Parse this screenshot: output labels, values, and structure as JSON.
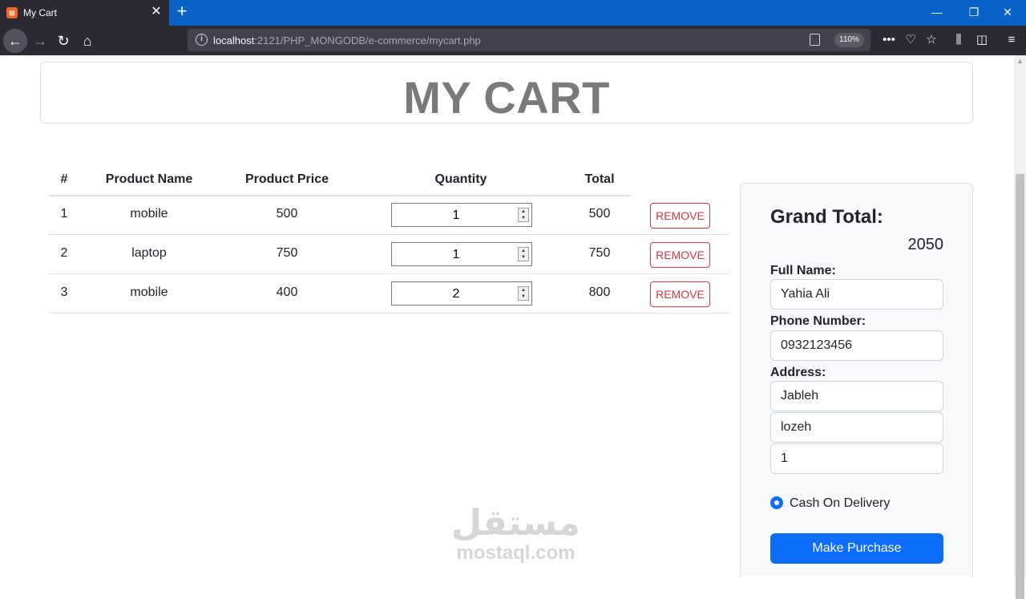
{
  "browser": {
    "tab_title": "My Cart",
    "favicon_letter": "⊠",
    "url_host": "localhost",
    "url_rest": ":2121/PHP_MONGODB/e-commerce/mycart.php",
    "zoom": "110%"
  },
  "page": {
    "title": "MY CART",
    "headers": {
      "index": "#",
      "name": "Product Name",
      "price": "Product Price",
      "qty": "Quantity",
      "total": "Total"
    },
    "remove_label": "REMOVE",
    "items": [
      {
        "index": "1",
        "name": "mobile",
        "price": "500",
        "qty": "1",
        "total": "500"
      },
      {
        "index": "2",
        "name": "laptop",
        "price": "750",
        "qty": "1",
        "total": "750"
      },
      {
        "index": "3",
        "name": "mobile",
        "price": "400",
        "qty": "2",
        "total": "800"
      }
    ]
  },
  "checkout": {
    "grand_total_label": "Grand Total:",
    "grand_total_value": "2050",
    "full_name_label": "Full Name:",
    "full_name": "Yahia Ali",
    "phone_label": "Phone Number:",
    "phone": "0932123456",
    "address_label": "Address:",
    "address_1": "Jableh",
    "address_2": "lozeh",
    "address_3": "1",
    "payment_label": "Cash On Delivery",
    "purchase_label": "Make Purchase"
  },
  "watermark": {
    "arabic": "مستقل",
    "latin": "mostaql.com"
  },
  "colors": {
    "accent": "#0d6efd",
    "danger": "#dc3545",
    "title_gray": "#7a7a7a"
  }
}
